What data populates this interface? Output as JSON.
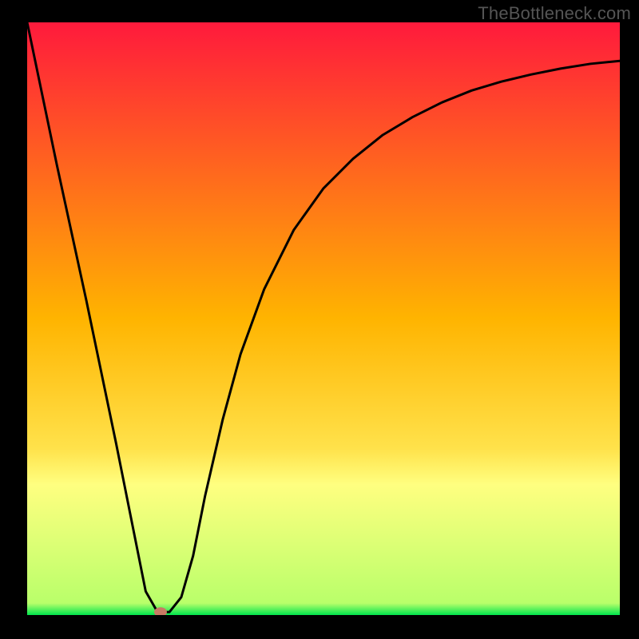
{
  "watermark": "TheBottleneck.com",
  "chart_data": {
    "type": "line",
    "title": "",
    "xlabel": "",
    "ylabel": "",
    "xlim": [
      0,
      100
    ],
    "ylim": [
      0,
      100
    ],
    "grid": false,
    "legend": false,
    "background_gradient": {
      "stops": [
        {
          "offset": 0,
          "color": "#ff1a3c"
        },
        {
          "offset": 50,
          "color": "#ffb400"
        },
        {
          "offset": 72,
          "color": "#ffe24b"
        },
        {
          "offset": 78,
          "color": "#ffff80"
        },
        {
          "offset": 98,
          "color": "#b9ff6a"
        },
        {
          "offset": 100,
          "color": "#00e64d"
        }
      ]
    },
    "series": [
      {
        "name": "bottleneck-curve",
        "color": "#000000",
        "x": [
          0,
          5,
          10,
          15,
          18,
          20,
          22,
          24,
          26,
          28,
          30,
          33,
          36,
          40,
          45,
          50,
          55,
          60,
          65,
          70,
          75,
          80,
          85,
          90,
          95,
          100
        ],
        "y": [
          100,
          76,
          53,
          29,
          14,
          4,
          0.5,
          0.5,
          3,
          10,
          20,
          33,
          44,
          55,
          65,
          72,
          77,
          81,
          84,
          86.5,
          88.5,
          90,
          91.2,
          92.2,
          93,
          93.5
        ]
      }
    ],
    "markers": [
      {
        "name": "min-marker",
        "x": 22.5,
        "y": 0.5,
        "color": "#c97a64",
        "rx": 8,
        "ry": 6
      }
    ]
  }
}
